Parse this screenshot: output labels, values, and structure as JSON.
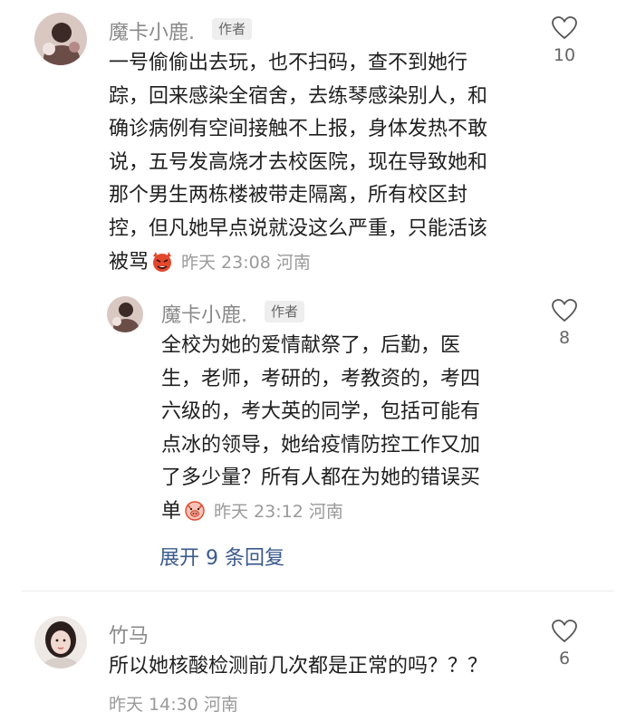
{
  "comments": [
    {
      "username": "魔卡小鹿.",
      "badge": "作者",
      "lines": [
        "一号偷偷出去玩，也不扫码，查不到她行",
        "踪，回来感染全宿舍，去练琴感染别人，和",
        "确诊病例有空间接触不上报，身体发热不敢",
        "说，五号发高烧才去校医院，现在导致她和",
        "那个男生两栋楼被带走隔离，所有校区封",
        "控，但凡她早点说就没这么严重，只能活该"
      ],
      "last_line": "被骂",
      "emoji_icon": "angry-devil-emoji",
      "time": "昨天 23:08",
      "location": "河南",
      "likes": "10",
      "reply": {
        "username": "魔卡小鹿.",
        "badge": "作者",
        "lines": [
          "全校为她的爱情献祭了，后勤，医",
          "生，老师，考研的，考教资的，考四",
          "六级的，考大英的同学，包括可能有",
          "点冰的领导，她给疫情防控工作又加",
          "了多少量？所有人都在为她的错误买"
        ],
        "last_line": "单",
        "emoji_icon": "pig-face-emoji",
        "time": "昨天 23:12",
        "location": "河南",
        "likes": "8"
      },
      "expand_label": "展开 9 条回复"
    },
    {
      "username": "竹马",
      "text": "所以她核酸检测前几次都是正常的吗？？？",
      "time": "昨天 14:30",
      "location": "河南",
      "likes": "6"
    }
  ],
  "colors": {
    "username": "#8a8a8a",
    "text": "#1f1f1f",
    "meta": "#9a9a9a",
    "expand_link": "#3a5a8c",
    "emoji_red": "#e2482c"
  }
}
